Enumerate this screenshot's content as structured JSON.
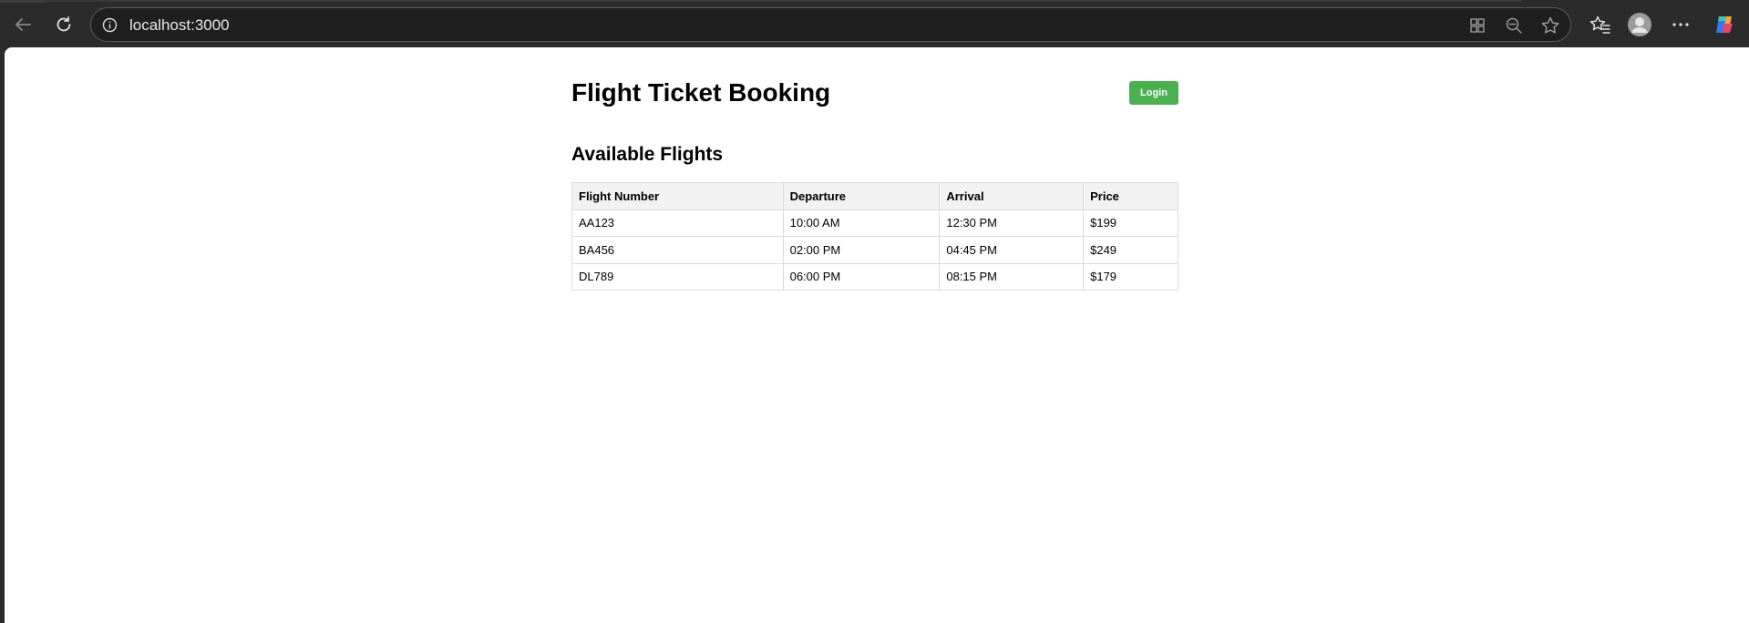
{
  "browser": {
    "url": "localhost:3000"
  },
  "page": {
    "title": "Flight Ticket Booking",
    "login_label": "Login",
    "login_color": "#4caf50",
    "section_title": "Available Flights"
  },
  "table": {
    "headers": [
      "Flight Number",
      "Departure",
      "Arrival",
      "Price"
    ],
    "rows": [
      [
        "AA123",
        "10:00 AM",
        "12:30 PM",
        "$199"
      ],
      [
        "BA456",
        "02:00 PM",
        "04:45 PM",
        "$249"
      ],
      [
        "DL789",
        "06:00 PM",
        "08:15 PM",
        "$179"
      ]
    ]
  },
  "icons": {
    "back": "arrow-left-icon",
    "reload": "reload-icon",
    "info": "info-icon",
    "app": "app-grid-icon",
    "zoom": "zoom-out-icon",
    "favorite": "star-icon",
    "favorites": "favorites-icon",
    "profile": "profile-avatar-icon",
    "menu": "more-icon",
    "copilot": "copilot-icon"
  }
}
